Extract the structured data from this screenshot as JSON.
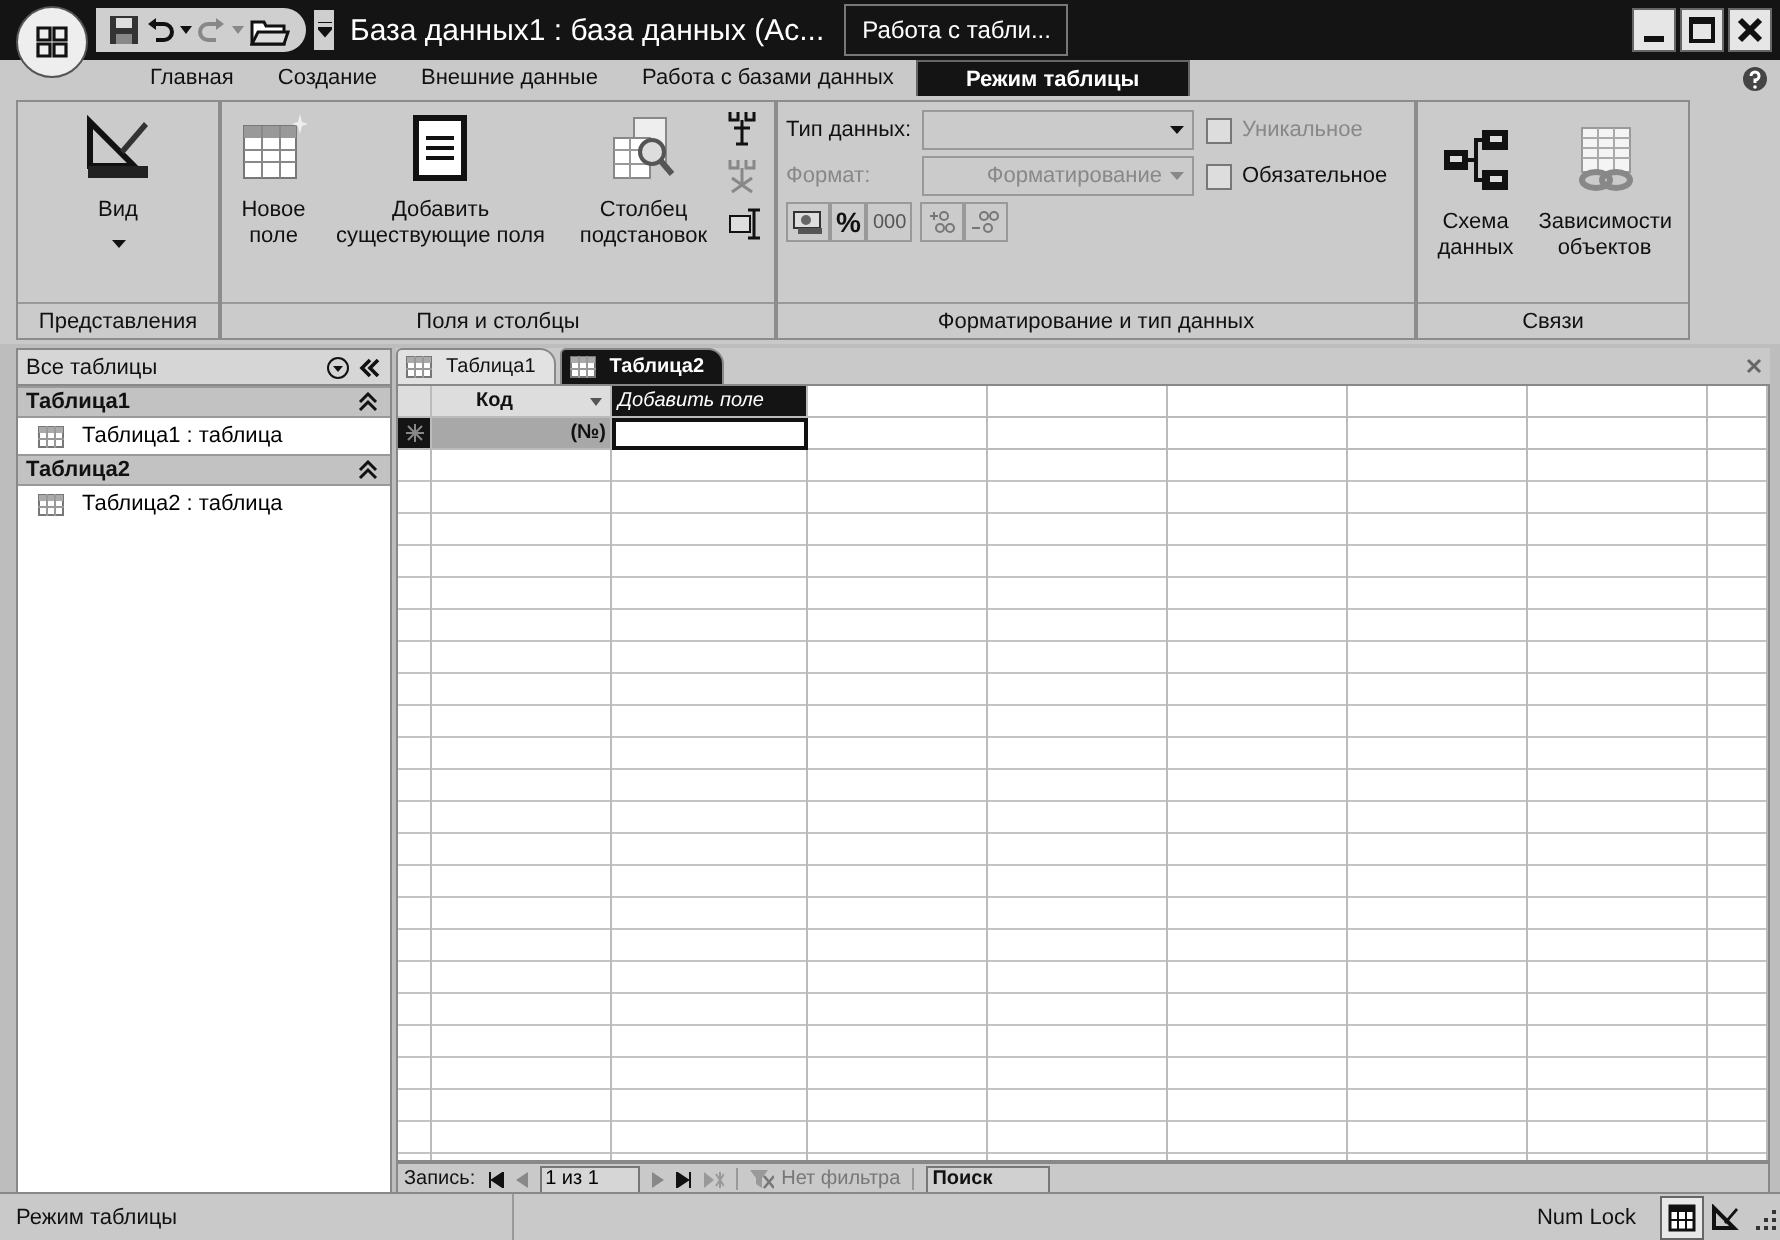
{
  "title_bar": {
    "title": "База данных1 : база данных (Ac...",
    "context_tab": "Работа с табли..."
  },
  "ribbon_tabs": [
    {
      "label": "Главная",
      "selected": false
    },
    {
      "label": "Создание",
      "selected": false
    },
    {
      "label": "Внешние данные",
      "selected": false
    },
    {
      "label": "Работа с базами данных",
      "selected": false
    },
    {
      "label": "Режим таблицы",
      "selected": true
    }
  ],
  "ribbon_groups": [
    {
      "kind": "buttons",
      "label": "Представления",
      "buttons": [
        {
          "label": "Вид",
          "dropdown": true
        }
      ]
    },
    {
      "kind": "buttons",
      "label": "Поля и столбцы",
      "buttons": [
        {
          "label": "Новое поле",
          "dropdown": false
        },
        {
          "label": "Добавить существующие поля",
          "dropdown": false
        },
        {
          "label": "Столбец подстановок",
          "dropdown": false
        }
      ]
    },
    {
      "kind": "fields",
      "label": "Форматирование и тип данных",
      "data_type": {
        "label": "Тип данных:"
      },
      "format": {
        "label": "Формат:",
        "value": "Форматирование",
        "disabled": true
      },
      "checkboxes": [
        {
          "label": "Уникальное",
          "checked": false,
          "disabled": true
        },
        {
          "label": "Обязательное",
          "checked": false,
          "disabled": false
        }
      ],
      "format_buttons": [
        "%",
        "000"
      ]
    },
    {
      "kind": "buttons",
      "label": "Связи",
      "buttons": [
        {
          "label": "Схема данных",
          "dropdown": false
        },
        {
          "label": "Зависимости объектов",
          "dropdown": false
        }
      ]
    }
  ],
  "navigation_pane": {
    "title": "Все таблицы",
    "groups": [
      {
        "label": "Таблица1",
        "expanded": true,
        "items": [
          "Таблица1 : таблица"
        ]
      },
      {
        "label": "Таблица2",
        "expanded": true,
        "items": [
          "Таблица2 : таблица"
        ]
      }
    ]
  },
  "document_tabs": [
    {
      "label": "Таблица1",
      "selected": false
    },
    {
      "label": "Таблица2",
      "selected": true
    }
  ],
  "datasheet": {
    "columns": [
      {
        "label": "Код",
        "kind": "field"
      },
      {
        "label": "Добавить поле",
        "kind": "add"
      }
    ],
    "new_row": [
      "(№)"
    ]
  },
  "record_navigator": {
    "label": "Запись:",
    "position": "1 из 1",
    "filter": "Нет фильтра",
    "search": {
      "placeholder": "Поиск"
    }
  },
  "status_bar": {
    "mode": "Режим таблицы",
    "indicator": "Num Lock",
    "views": [
      {
        "kind": "datasheet",
        "selected": true
      },
      {
        "kind": "design",
        "selected": false
      }
    ]
  }
}
